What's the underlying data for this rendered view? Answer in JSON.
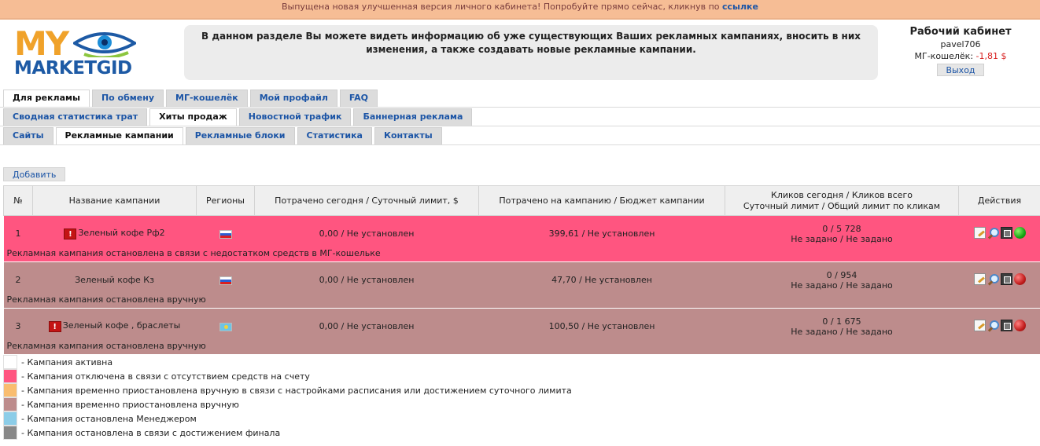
{
  "topbar": {
    "text": "Выпущена новая улучшенная версия личного кабинета! Попробуйте прямо сейчас, кликнув по",
    "link": "ссылке"
  },
  "logo": {
    "line1": "MY",
    "line2": "MARKETGID"
  },
  "info": {
    "line1": "В данном разделе Вы можете видеть информацию об уже существующих Ваших рекламных кампаниях, вносить в них",
    "line2": "изменения, а также создавать новые рекламные кампании."
  },
  "cabinet": {
    "title": "Рабочий кабинет",
    "user": "pavel706",
    "wallet_label": "МГ-кошелёк:",
    "wallet_value": "-1,81 $",
    "logout": "Выход"
  },
  "tabs1": [
    "Для рекламы",
    "По обмену",
    "МГ-кошелёк",
    "Мой профайл",
    "FAQ"
  ],
  "tabs2": [
    "Сводная статистика трат",
    "Хиты продаж",
    "Новостной трафик",
    "Баннерная реклама"
  ],
  "tabs3": [
    "Сайты",
    "Рекламные кампании",
    "Рекламные блоки",
    "Статистика",
    "Контакты"
  ],
  "add_button": "Добавить",
  "table": {
    "headers": {
      "num": "№",
      "name": "Название кампании",
      "regions": "Регионы",
      "spent_today": "Потрачено сегодня / Суточный лимит, $",
      "spent_total": "Потрачено на кампанию / Бюджет кампании",
      "clicks_line1": "Кликов сегодня / Кликов всего",
      "clicks_line2": "Суточный лимит / Общий лимит по кликам",
      "actions": "Действия"
    },
    "rows": [
      {
        "num": "1",
        "name": "Зеленый кофе Рф2",
        "spent_today": "0,00 / Не установлен",
        "spent_total": "399,61 / Не установлен",
        "clicks": "0 / 5 728",
        "limits": "Не задано / Не задано",
        "note": "Рекламная кампания остановлена в связи с недостатком средств в МГ-кошельке"
      },
      {
        "num": "2",
        "name": "Зеленый кофе Кз",
        "spent_today": "0,00 / Не установлен",
        "spent_total": "47,70 / Не установлен",
        "clicks": "0 / 954",
        "limits": "Не задано / Не задано",
        "note": "Рекламная кампания остановлена вручную"
      },
      {
        "num": "3",
        "name": "Зеленый кофе , браслеты",
        "spent_today": "0,00 / Не установлен",
        "spent_total": "100,50 / Не установлен",
        "clicks": "0 / 1 675",
        "limits": "Не задано / Не задано",
        "note": "Рекламная кампания остановлена вручную"
      }
    ]
  },
  "legend": [
    {
      "color": "#ffffff",
      "text": "- Кампания активна"
    },
    {
      "color": "#ff5580",
      "text": "- Кампания отключена в связи с отсутствием средств на счету"
    },
    {
      "color": "#f9bd6f",
      "text": "- Кампания временно приостановлена вручную в связи с настройками расписания или достижением суточного лимита"
    },
    {
      "color": "#bd8c8c",
      "text": "- Кампания временно приостановлена вручную"
    },
    {
      "color": "#8ccde8",
      "text": "- Кампания остановлена Менеджером"
    },
    {
      "color": "#888888",
      "text": "- Кампания остановлена в связи с достижением финала"
    }
  ]
}
